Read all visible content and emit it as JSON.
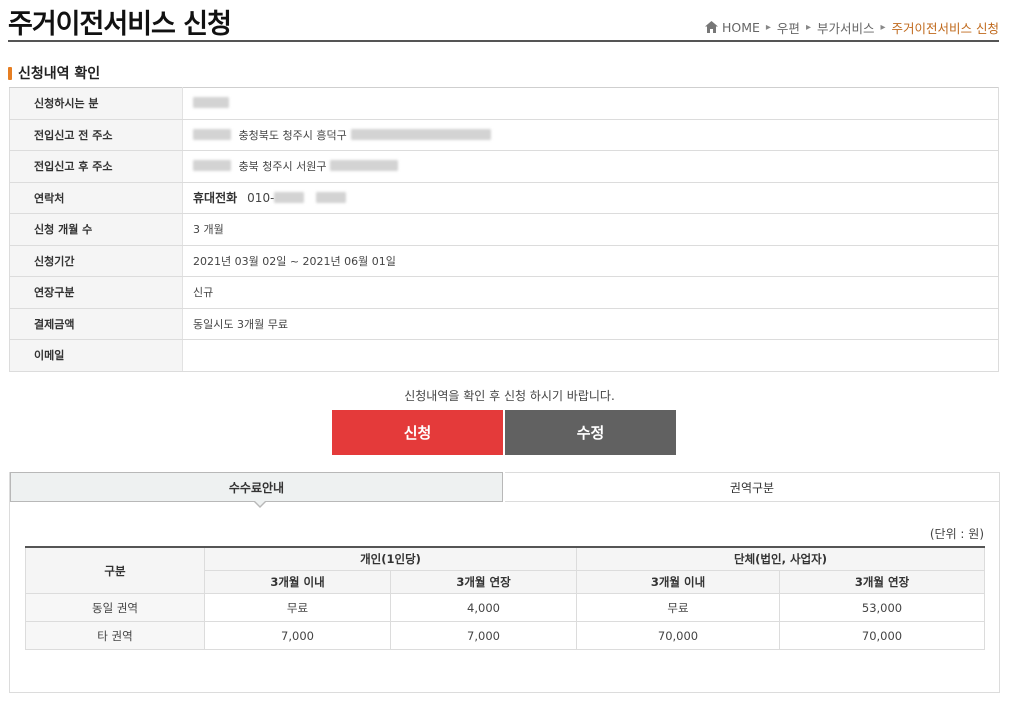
{
  "page": {
    "title": "주거이전서비스 신청",
    "breadcrumb": [
      "HOME",
      "우편",
      "부가서비스",
      "주거이전서비스 신청"
    ]
  },
  "section_title": "신청내역 확인",
  "info_rows": {
    "applicant": {
      "label": "신청하시는 분"
    },
    "prev_address": {
      "label": "전입신고 전 주소",
      "value": "충청북도 청주시 흥덕구"
    },
    "new_address": {
      "label": "전입신고 후 주소",
      "value": "충북 청주시 서원구"
    },
    "contact": {
      "label": "연락처",
      "phone_label": "휴대전화",
      "phone_prefix": "010-"
    },
    "months": {
      "label": "신청 개월 수",
      "value": "3 개월"
    },
    "period": {
      "label": "신청기간",
      "value": "2021년 03월 02일 ~ 2021년 06월 01일"
    },
    "extension": {
      "label": "연장구분",
      "value": "신규"
    },
    "payment": {
      "label": "결제금액",
      "value": "동일시도 3개월 무료"
    },
    "email": {
      "label": "이메일",
      "value": ""
    }
  },
  "notice": "신청내역을 확인 후 신청 하시기 바랍니다.",
  "buttons": {
    "apply": "신청",
    "edit": "수정"
  },
  "tabs": {
    "fee_info": "수수료안내",
    "region": "권역구분"
  },
  "unit": "(단위 : 원)",
  "fee_table": {
    "col_category": "구분",
    "col_individual": "개인(1인당)",
    "col_group": "단체(법인, 사업자)",
    "sub_within": "3개월 이내",
    "sub_extend": "3개월 연장",
    "rows": [
      {
        "label": "동일 권역",
        "values": [
          "무료",
          "4,000",
          "무료",
          "53,000"
        ]
      },
      {
        "label": "타 권역",
        "values": [
          "7,000",
          "7,000",
          "70,000",
          "70,000"
        ]
      }
    ]
  },
  "colors": {
    "accent_red": "#e43a3a",
    "button_gray": "#616161",
    "breadcrumb_current": "#c06a1d",
    "section_bar": "#e67e22"
  },
  "icons": [
    "home-icon",
    "chevron-right-icon"
  ]
}
